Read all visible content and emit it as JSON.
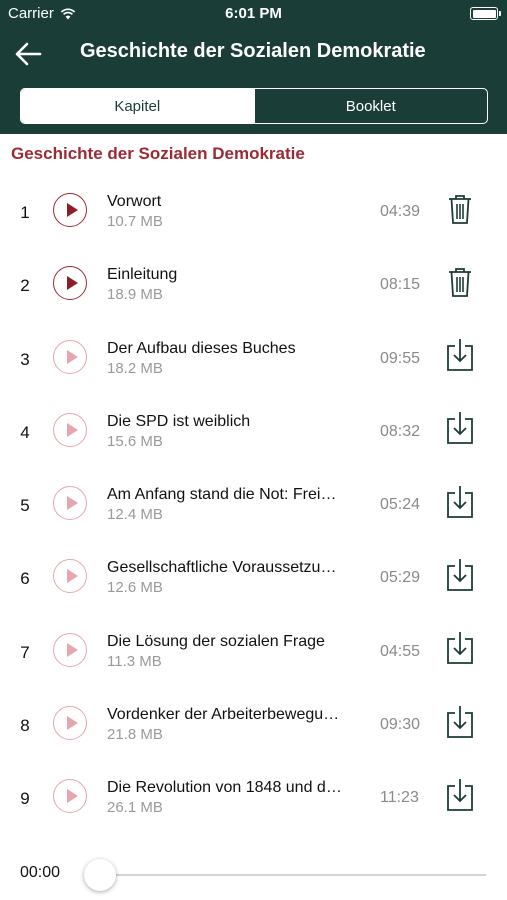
{
  "status_bar": {
    "carrier": "Carrier",
    "time": "6:01 PM",
    "battery_level": 1.0
  },
  "nav": {
    "title": "Geschichte der Sozialen Demokratie",
    "back_icon": "arrow-left-icon"
  },
  "tabs": [
    {
      "label": "Kapitel",
      "selected": true
    },
    {
      "label": "Booklet",
      "selected": false
    }
  ],
  "section": {
    "title": "Geschichte der Sozialen Demokratie"
  },
  "chapters": [
    {
      "number": "1",
      "title": "Vorwort",
      "size": "10.7 MB",
      "duration": "04:39",
      "downloaded": true,
      "action_icon": "trash-icon"
    },
    {
      "number": "2",
      "title": "Einleitung",
      "size": "18.9 MB",
      "duration": "08:15",
      "downloaded": true,
      "action_icon": "trash-icon"
    },
    {
      "number": "3",
      "title": "Der Aufbau dieses Buches",
      "size": "18.2 MB",
      "duration": "09:55",
      "downloaded": false,
      "action_icon": "download-icon"
    },
    {
      "number": "4",
      "title": "Die SPD ist weiblich",
      "size": "15.6 MB",
      "duration": "08:32",
      "downloaded": false,
      "action_icon": "download-icon"
    },
    {
      "number": "5",
      "title": "Am Anfang stand die Not: Frei…",
      "size": "12.4 MB",
      "duration": "05:24",
      "downloaded": false,
      "action_icon": "download-icon"
    },
    {
      "number": "6",
      "title": "Gesellschaftliche Voraussetzu…",
      "size": "12.6 MB",
      "duration": "05:29",
      "downloaded": false,
      "action_icon": "download-icon"
    },
    {
      "number": "7",
      "title": "Die Lösung der sozialen Frage",
      "size": "11.3 MB",
      "duration": "04:55",
      "downloaded": false,
      "action_icon": "download-icon"
    },
    {
      "number": "8",
      "title": "Vordenker der Arbeiterbewegu…",
      "size": "21.8 MB",
      "duration": "09:30",
      "downloaded": false,
      "action_icon": "download-icon"
    },
    {
      "number": "9",
      "title": "Die Revolution von 1848 und d…",
      "size": "26.1 MB",
      "duration": "11:23",
      "downloaded": false,
      "action_icon": "download-icon"
    }
  ],
  "player": {
    "current_time": "00:00",
    "progress": 0
  },
  "colors": {
    "header": "#1b3d38",
    "accent": "#9c2a35",
    "play_dim": "#e5a6ad",
    "action": "#1b3d38"
  }
}
